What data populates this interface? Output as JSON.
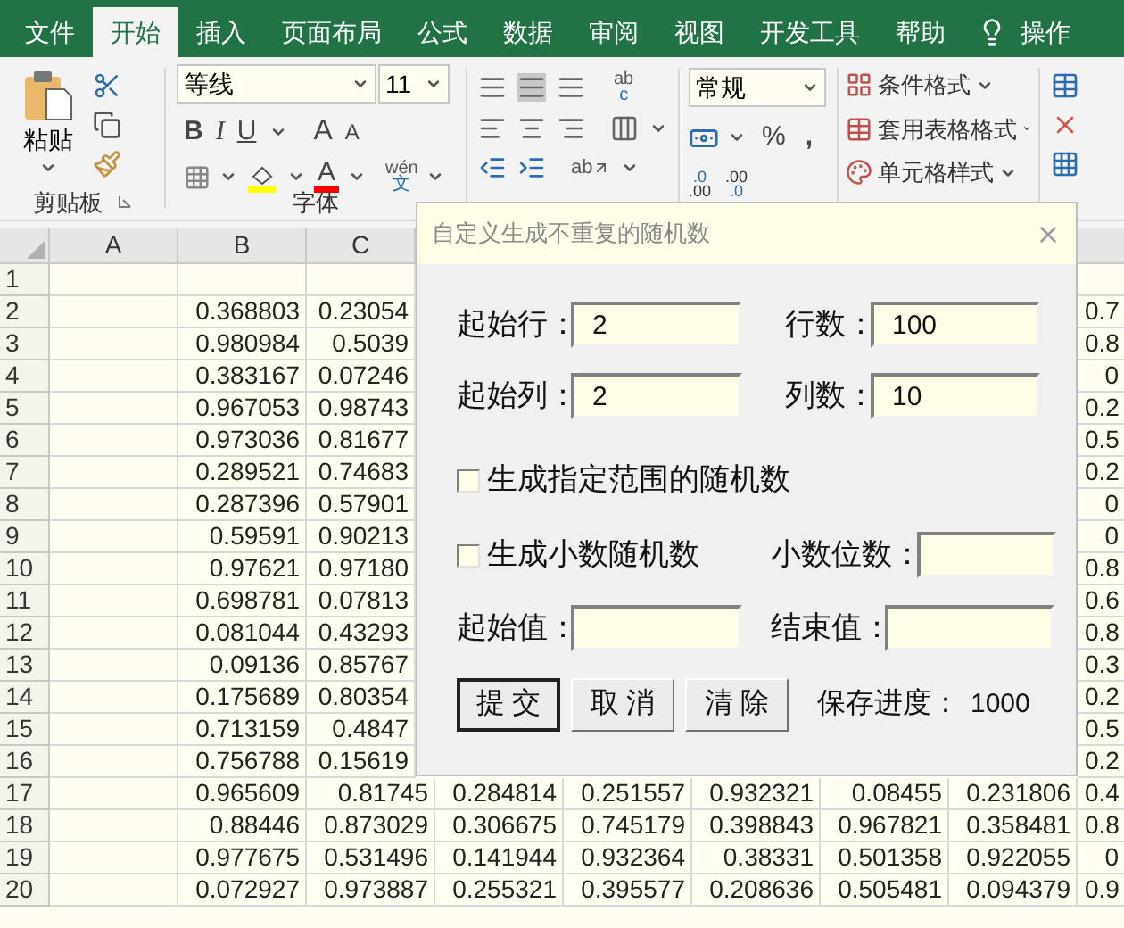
{
  "tabs": [
    {
      "label": "文件",
      "selected": false
    },
    {
      "label": "开始",
      "selected": true
    },
    {
      "label": "插入",
      "selected": false
    },
    {
      "label": "页面布局",
      "selected": false
    },
    {
      "label": "公式",
      "selected": false
    },
    {
      "label": "数据",
      "selected": false
    },
    {
      "label": "审阅",
      "selected": false
    },
    {
      "label": "视图",
      "selected": false
    },
    {
      "label": "开发工具",
      "selected": false
    },
    {
      "label": "帮助",
      "selected": false
    }
  ],
  "tell_me": "操作",
  "ribbon": {
    "clipboard": {
      "paste": "粘贴",
      "label": "剪贴板"
    },
    "font": {
      "name": "等线",
      "size": "11",
      "bold": "B",
      "italic": "I",
      "underline": "U",
      "grow": "A",
      "shrink": "A",
      "font_color": "A",
      "phonetic_top": "wén",
      "phonetic_bottom": "文",
      "label": "字体"
    },
    "alignment": {
      "wrap_top": "ab",
      "wrap_bottom": "c",
      "orientation": "ab"
    },
    "number": {
      "format": "常规",
      "percent": "%",
      "comma": ",",
      "increase_decimal": [
        ".0",
        ".00"
      ],
      "decrease_decimal": [
        ".00",
        ".0"
      ]
    },
    "styles": [
      "条件格式",
      "套用表格格式",
      "单元格样式"
    ]
  },
  "sheet": {
    "columns": [
      "A",
      "B",
      "C"
    ],
    "rows": [
      {
        "number": "1",
        "kind": "under_dialog"
      },
      {
        "number": "2",
        "kind": "under_dialog",
        "cells": [
          "0.368803",
          "0.23054",
          "0.7"
        ]
      },
      {
        "number": "3",
        "kind": "under_dialog",
        "cells": [
          "0.980984",
          "0.5039",
          "0.8"
        ]
      },
      {
        "number": "4",
        "kind": "under_dialog",
        "cells": [
          "0.383167",
          "0.07246",
          "0"
        ]
      },
      {
        "number": "5",
        "kind": "under_dialog",
        "cells": [
          "0.967053",
          "0.98743",
          "0.2"
        ]
      },
      {
        "number": "6",
        "kind": "under_dialog",
        "cells": [
          "0.973036",
          "0.81677",
          "0.5"
        ]
      },
      {
        "number": "7",
        "kind": "under_dialog",
        "cells": [
          "0.289521",
          "0.74683",
          "0.2"
        ]
      },
      {
        "number": "8",
        "kind": "under_dialog",
        "cells": [
          "0.287396",
          "0.57901",
          "0"
        ]
      },
      {
        "number": "9",
        "kind": "under_dialog",
        "cells": [
          "0.59591",
          "0.90213",
          "0"
        ]
      },
      {
        "number": "10",
        "kind": "under_dialog",
        "cells": [
          "0.97621",
          "0.97180",
          "0.8"
        ]
      },
      {
        "number": "11",
        "kind": "under_dialog",
        "cells": [
          "0.698781",
          "0.07813",
          "0.6"
        ]
      },
      {
        "number": "12",
        "kind": "under_dialog",
        "cells": [
          "0.081044",
          "0.43293",
          "0.8"
        ]
      },
      {
        "number": "13",
        "kind": "under_dialog",
        "cells": [
          "0.09136",
          "0.85767",
          "0.3"
        ]
      },
      {
        "number": "14",
        "kind": "under_dialog",
        "cells": [
          "0.175689",
          "0.80354",
          "0.2"
        ]
      },
      {
        "number": "15",
        "kind": "under_dialog",
        "cells": [
          "0.713159",
          "0.4847",
          "0.5"
        ]
      },
      {
        "number": "16",
        "kind": "under_dialog",
        "cells": [
          "0.756788",
          "0.15619",
          "0.2"
        ]
      },
      {
        "number": "17",
        "kind": "full",
        "cells": [
          "0.965609",
          "0.81745",
          "0.284814",
          "0.251557",
          "0.932321",
          "0.08455",
          "0.231806",
          "0.4"
        ]
      },
      {
        "number": "18",
        "kind": "full",
        "cells": [
          "0.88446",
          "0.873029",
          "0.306675",
          "0.745179",
          "0.398843",
          "0.967821",
          "0.358481",
          "0.8"
        ]
      },
      {
        "number": "19",
        "kind": "full",
        "cells": [
          "0.977675",
          "0.531496",
          "0.141944",
          "0.932364",
          "0.38331",
          "0.501358",
          "0.922055",
          "0"
        ]
      },
      {
        "number": "20",
        "kind": "full",
        "cells": [
          "0.072927",
          "0.973887",
          "0.255321",
          "0.395577",
          "0.208636",
          "0.505481",
          "0.094379",
          "0.9"
        ]
      }
    ]
  },
  "dialog": {
    "title": "自定义生成不重复的随机数",
    "rows": [
      {
        "kind": "fields",
        "items": [
          {
            "label": "起始行：",
            "value": "2"
          },
          {
            "label": "行数：",
            "value": "100"
          }
        ]
      },
      {
        "kind": "fields",
        "items": [
          {
            "label": "起始列：",
            "value": "2"
          },
          {
            "label": "列数：",
            "value": "10"
          }
        ]
      },
      {
        "kind": "checkbox",
        "label": "生成指定范围的随机数",
        "checked": false
      },
      {
        "kind": "checkbox_field",
        "label": "生成小数随机数",
        "checked": false,
        "field": {
          "label": "小数位数："
        }
      },
      {
        "kind": "fields",
        "items": [
          {
            "label": "起始值："
          },
          {
            "label": "结束值："
          }
        ]
      }
    ],
    "buttons": [
      {
        "label": "提 交",
        "default": true
      },
      {
        "label": "取 消",
        "default": false
      },
      {
        "label": "清 除",
        "default": false
      }
    ],
    "progress": {
      "label": "保存进度：",
      "value": "1000"
    }
  }
}
